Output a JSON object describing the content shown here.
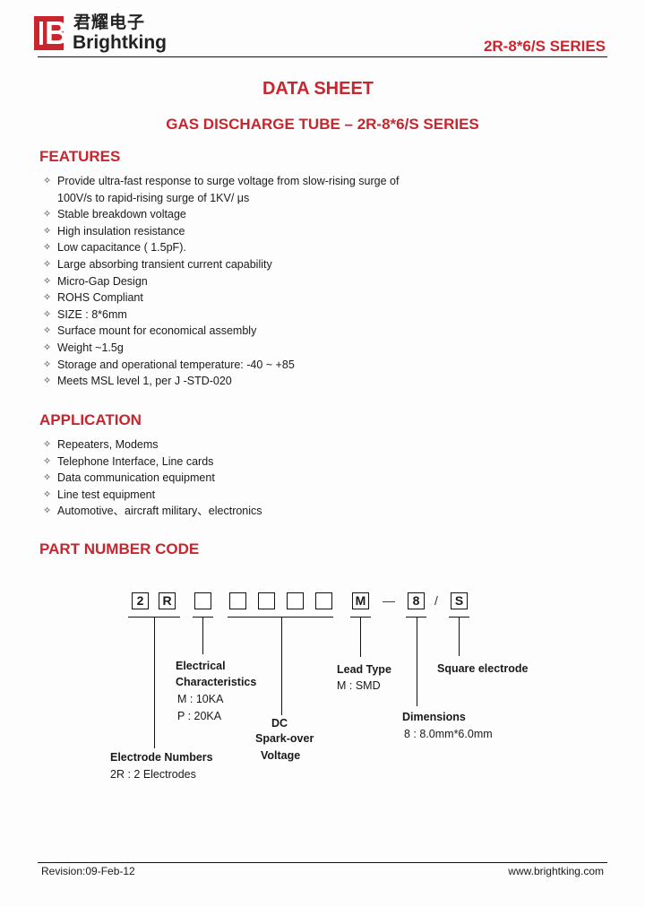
{
  "header": {
    "logo_letter": "B",
    "brand_cn": "君耀电子",
    "brand_en": "Brightking",
    "series": "2R-8*6/S SERIES",
    "brand_color": "#c8262e"
  },
  "title": "DATA SHEET",
  "subtitle": "GAS DISCHARGE TUBE – 2R-8*6/S SERIES",
  "features": {
    "heading": "FEATURES",
    "bullet_icon": "diamond-star-icon",
    "items": [
      {
        "line1": "Provide ultra-fast response to surge voltage from slow-rising surge of",
        "line2": "100V/s to rapid-rising surge of 1KV/ μs"
      },
      {
        "line1": "Stable breakdown voltage"
      },
      {
        "line1": "High insulation resistance"
      },
      {
        "line1": "Low capacitance (   1.5pF)."
      },
      {
        "line1": "Large absorbing transient current capability"
      },
      {
        "line1": "Micro-Gap Design"
      },
      {
        "line1": "ROHS Compliant"
      },
      {
        "line1": "SIZE : 8*6mm"
      },
      {
        "line1": "Surface mount for economical assembly"
      },
      {
        "line1": "Weight ~1.5g"
      },
      {
        "line1": "Storage and operational temperature:  -40      ~ +85"
      },
      {
        "line1": "Meets MSL level 1, per J -STD-020"
      }
    ]
  },
  "application": {
    "heading": "APPLICATION",
    "items": [
      "Repeaters, Modems",
      "Telephone Interface, Line cards",
      "Data communication equipment",
      "Line test equipment",
      "Automotive、aircraft military、electronics"
    ]
  },
  "part_number_code": {
    "heading": "PART NUMBER CODE",
    "boxes": [
      "2",
      "R",
      "",
      "",
      "",
      "",
      "",
      "M",
      "8",
      "S"
    ],
    "dash": "—",
    "slash": "/",
    "labels": {
      "electrode_title": "Electrode Numbers",
      "electrode_value": "2R : 2 Electrodes",
      "electrical_title1": "Electrical",
      "electrical_title2": "Characteristics",
      "electrical_m": "M : 10KA",
      "electrical_p": "P : 20KA",
      "dc_title1": "DC",
      "dc_title2": "Spark-over",
      "dc_title3": "Voltage",
      "lead_title": "Lead Type",
      "lead_value": "M : SMD",
      "dim_title": "Dimensions",
      "dim_value": "8 : 8.0mm*6.0mm",
      "square_title": "Square electrode"
    }
  },
  "footer": {
    "revision": "Revision:09-Feb-12",
    "website": "www.brightking.com"
  }
}
